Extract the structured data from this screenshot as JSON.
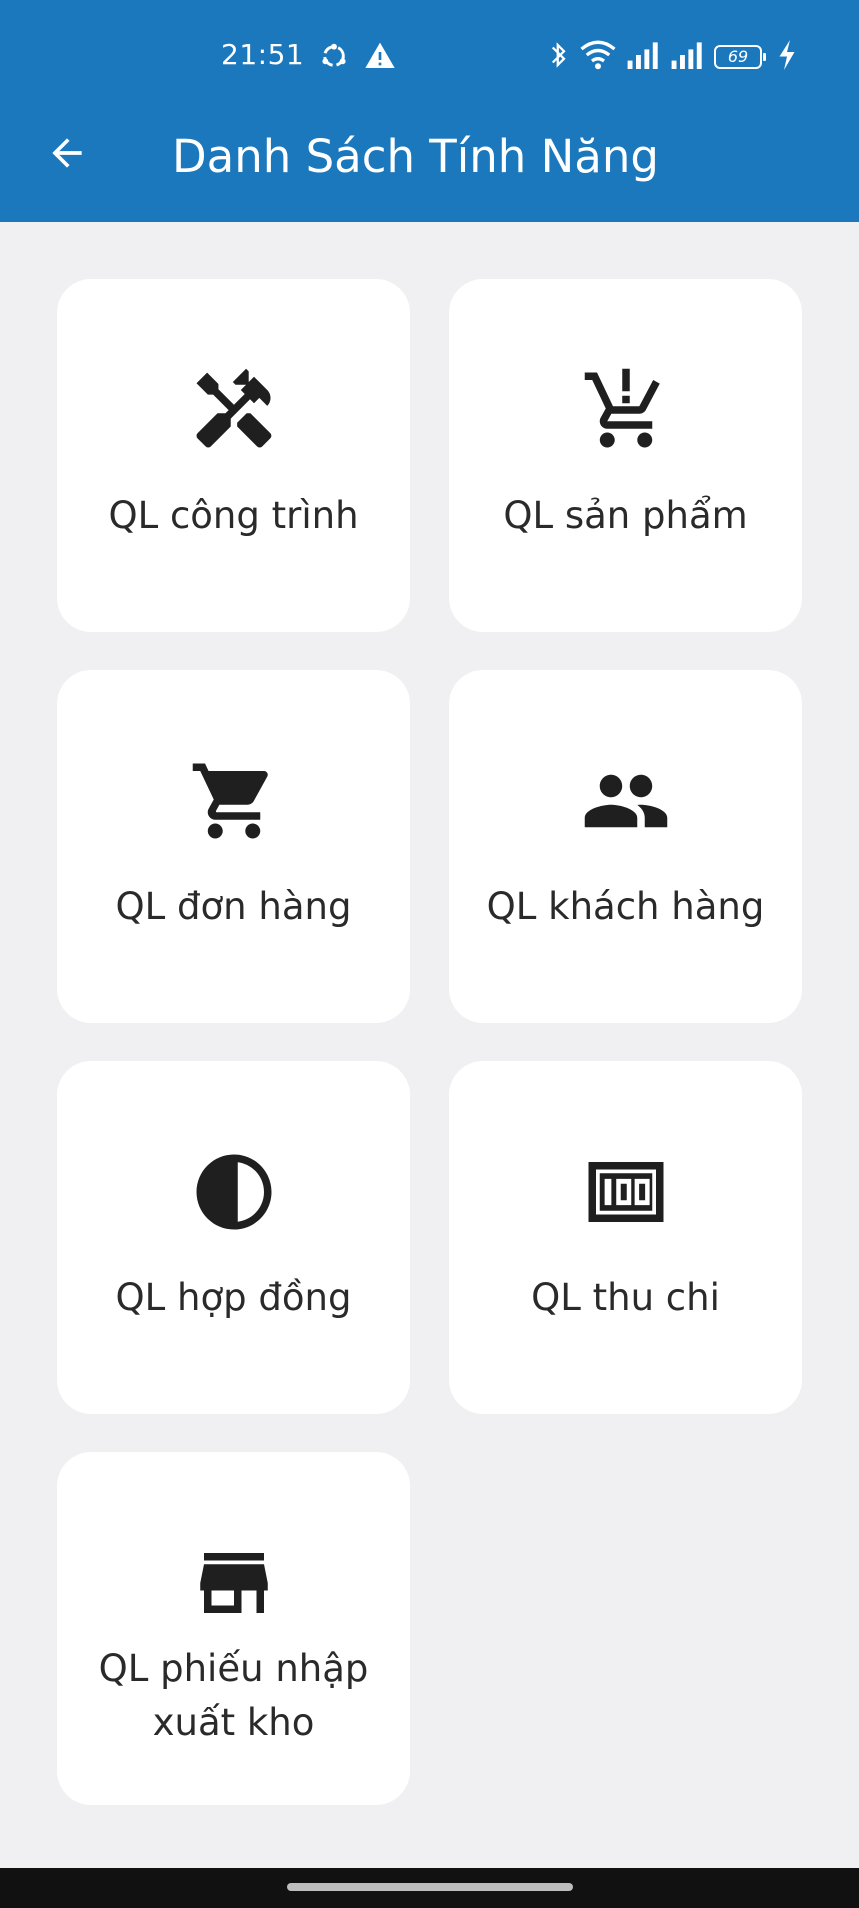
{
  "status_bar": {
    "time": "21:51",
    "left_icons": [
      "sync-icon",
      "warning-icon"
    ],
    "right_icons": [
      "bluetooth-icon",
      "wifi-icon",
      "signal-icon",
      "signal-icon"
    ],
    "battery": "69",
    "charging": true
  },
  "appbar": {
    "title": "Danh Sách Tính Năng",
    "back_icon": "arrow-back-icon",
    "color": "#1c78bd"
  },
  "features": [
    {
      "label": "QL công trình",
      "icon": "tools-icon"
    },
    {
      "label": "QL sản phẩm",
      "icon": "cart-alert-icon"
    },
    {
      "label": "QL đơn hàng",
      "icon": "cart-icon"
    },
    {
      "label": "QL khách hàng",
      "icon": "people-icon"
    },
    {
      "label": "QL hợp đồng",
      "icon": "contrast-icon"
    },
    {
      "label": "QL thu chi",
      "icon": "counter-100-icon"
    },
    {
      "label": "QL phiếu nhập xuất kho",
      "icon": "store-icon"
    }
  ]
}
